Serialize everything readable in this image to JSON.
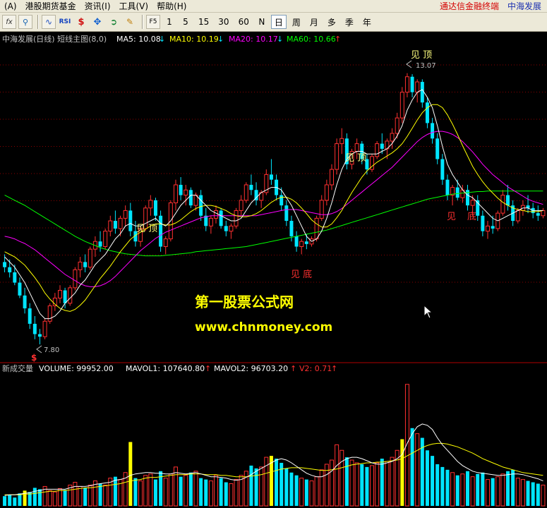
{
  "menubar": {
    "items": [
      "(A)",
      "港股期货基金",
      "资讯(I)",
      "工具(V)",
      "帮助(H)"
    ],
    "title_terminal": "通达信金融终端",
    "title_stock": "中海发展"
  },
  "toolbar": {
    "icons": [
      "fx-icon",
      "search-icon",
      "wave-icon",
      "rsi-icon",
      "dollar-icon",
      "move-icon",
      "exit-icon",
      "pen-icon"
    ],
    "f5_label": "F5",
    "periods": [
      "1",
      "5",
      "15",
      "30",
      "60",
      "N",
      "日",
      "周",
      "月",
      "多",
      "季",
      "年"
    ],
    "active_period": "日"
  },
  "price_panel": {
    "header_label": "中海发展(日线) 短线主图(8,0)",
    "ma5": "MA5: 10.08",
    "ma10": "MA10: 10.19",
    "ma20": "MA20: 10.17",
    "ma60": "MA60: 10.66",
    "colors": {
      "ma5": "#ffffff",
      "ma10": "#ffff00",
      "ma20": "#ff00ff",
      "ma60": "#00ff00",
      "up": "#ff3030",
      "down": "#00e5ff",
      "grid": "#8b0000"
    },
    "annotations": [
      {
        "text": "见 顶",
        "color": "#ffff7f"
      },
      {
        "text": "见 顶",
        "color": "#ffff7f"
      },
      {
        "text": "见 顶",
        "color": "#ffff7f"
      },
      {
        "text": "见 底",
        "color": "#ff3030"
      },
      {
        "text": "见",
        "color": "#ff3030"
      },
      {
        "text": "底",
        "color": "#ff3030"
      }
    ],
    "high_marker": "13.07",
    "low_marker": "7.80",
    "signal_glyph": "$"
  },
  "watermark": {
    "line1": "第一股票公式网",
    "line2": "www.chnmoney.com",
    "color": "#ffff00"
  },
  "volume_panel": {
    "header_label": "新成交量",
    "volume": "VOLUME: 99952.00",
    "mavol1": "MAVOL1: 107640.80",
    "mavol2": "MAVOL2: 96703.20",
    "v2": "V2: 0.71",
    "colors": {
      "label": "#ffffff",
      "v2": "#ff3030",
      "highlight": "#ffff00"
    }
  },
  "chart_data": {
    "type": "candlestick",
    "ohlc": [
      [
        9.4,
        9.55,
        9.2,
        9.3
      ],
      [
        9.3,
        9.45,
        9.1,
        9.2
      ],
      [
        9.2,
        9.35,
        8.95,
        9.0
      ],
      [
        9.0,
        9.1,
        8.7,
        8.75
      ],
      [
        8.75,
        8.9,
        8.4,
        8.5
      ],
      [
        8.5,
        8.6,
        8.1,
        8.2
      ],
      [
        8.2,
        8.35,
        7.9,
        8.0
      ],
      [
        8.0,
        8.1,
        7.8,
        7.95
      ],
      [
        7.95,
        8.3,
        7.9,
        8.25
      ],
      [
        8.25,
        8.6,
        8.2,
        8.55
      ],
      [
        8.55,
        8.8,
        8.45,
        8.7
      ],
      [
        8.7,
        8.95,
        8.6,
        8.85
      ],
      [
        8.85,
        8.9,
        8.5,
        8.6
      ],
      [
        8.6,
        8.95,
        8.55,
        8.9
      ],
      [
        8.9,
        9.3,
        8.85,
        9.25
      ],
      [
        9.25,
        9.5,
        9.1,
        9.4
      ],
      [
        9.4,
        9.55,
        9.2,
        9.3
      ],
      [
        9.3,
        9.7,
        9.25,
        9.65
      ],
      [
        9.65,
        9.9,
        9.5,
        9.8
      ],
      [
        9.8,
        10.0,
        9.6,
        9.7
      ],
      [
        9.7,
        10.05,
        9.65,
        10.0
      ],
      [
        10.0,
        10.3,
        9.9,
        10.2
      ],
      [
        10.2,
        10.4,
        9.95,
        10.05
      ],
      [
        10.05,
        10.3,
        9.9,
        10.25
      ],
      [
        10.25,
        10.5,
        10.1,
        10.4
      ],
      [
        10.4,
        10.55,
        9.9,
        10.0
      ],
      [
        10.0,
        10.2,
        9.7,
        9.8
      ],
      [
        9.8,
        10.1,
        9.7,
        10.05
      ],
      [
        10.05,
        10.5,
        10.0,
        10.45
      ],
      [
        10.45,
        10.7,
        10.3,
        10.6
      ],
      [
        10.6,
        10.65,
        10.2,
        10.3
      ],
      [
        10.3,
        10.4,
        9.6,
        9.7
      ],
      [
        9.7,
        9.9,
        9.55,
        9.85
      ],
      [
        9.85,
        10.6,
        9.8,
        10.55
      ],
      [
        10.55,
        11.0,
        10.4,
        10.9
      ],
      [
        10.9,
        11.05,
        10.6,
        10.7
      ],
      [
        10.7,
        10.9,
        10.5,
        10.8
      ],
      [
        10.8,
        10.85,
        10.45,
        10.5
      ],
      [
        10.5,
        10.75,
        10.4,
        10.7
      ],
      [
        10.7,
        10.8,
        10.2,
        10.3
      ],
      [
        10.3,
        10.45,
        10.0,
        10.1
      ],
      [
        10.1,
        10.3,
        9.95,
        10.25
      ],
      [
        10.25,
        10.5,
        10.15,
        10.4
      ],
      [
        10.4,
        10.45,
        10.05,
        10.1
      ],
      [
        10.1,
        10.2,
        9.9,
        10.0
      ],
      [
        10.0,
        10.15,
        9.85,
        10.1
      ],
      [
        10.1,
        10.45,
        10.05,
        10.4
      ],
      [
        10.4,
        10.7,
        10.3,
        10.6
      ],
      [
        10.6,
        10.95,
        10.55,
        10.9
      ],
      [
        10.9,
        11.1,
        10.7,
        10.8
      ],
      [
        10.8,
        10.95,
        10.5,
        10.6
      ],
      [
        10.6,
        10.8,
        10.45,
        10.75
      ],
      [
        10.75,
        11.2,
        10.7,
        11.1
      ],
      [
        11.1,
        11.4,
        10.9,
        11.0
      ],
      [
        11.0,
        11.1,
        10.6,
        10.7
      ],
      [
        10.7,
        10.85,
        10.4,
        10.5
      ],
      [
        10.5,
        10.6,
        10.1,
        10.2
      ],
      [
        10.2,
        10.3,
        9.8,
        9.9
      ],
      [
        9.9,
        10.0,
        9.6,
        9.7
      ],
      [
        9.7,
        9.85,
        9.55,
        9.8
      ],
      [
        9.8,
        9.95,
        9.65,
        9.75
      ],
      [
        9.75,
        9.9,
        9.7,
        9.85
      ],
      [
        9.85,
        10.3,
        9.8,
        10.25
      ],
      [
        10.25,
        10.7,
        10.2,
        10.6
      ],
      [
        10.6,
        11.0,
        10.5,
        10.9
      ],
      [
        10.9,
        11.3,
        10.8,
        11.2
      ],
      [
        11.2,
        11.8,
        11.1,
        11.7
      ],
      [
        11.7,
        12.0,
        11.5,
        11.8
      ],
      [
        11.8,
        11.9,
        11.2,
        11.3
      ],
      [
        11.3,
        11.6,
        11.2,
        11.55
      ],
      [
        11.55,
        11.8,
        11.4,
        11.7
      ],
      [
        11.7,
        11.75,
        11.3,
        11.4
      ],
      [
        11.4,
        11.5,
        11.1,
        11.2
      ],
      [
        11.2,
        11.5,
        11.15,
        11.45
      ],
      [
        11.45,
        11.75,
        11.4,
        11.7
      ],
      [
        11.7,
        11.9,
        11.5,
        11.6
      ],
      [
        11.6,
        11.8,
        11.4,
        11.75
      ],
      [
        11.75,
        12.0,
        11.6,
        11.9
      ],
      [
        11.9,
        12.3,
        11.8,
        12.2
      ],
      [
        12.2,
        12.8,
        12.1,
        12.7
      ],
      [
        12.7,
        13.07,
        12.6,
        13.0
      ],
      [
        13.0,
        13.05,
        12.6,
        12.7
      ],
      [
        12.7,
        12.95,
        12.5,
        12.9
      ],
      [
        12.9,
        12.95,
        12.4,
        12.5
      ],
      [
        12.5,
        12.6,
        12.0,
        12.1
      ],
      [
        12.1,
        12.2,
        11.7,
        11.8
      ],
      [
        11.8,
        11.9,
        11.3,
        11.4
      ],
      [
        11.4,
        11.5,
        10.9,
        11.0
      ],
      [
        11.0,
        11.1,
        10.6,
        10.7
      ],
      [
        10.7,
        10.9,
        10.5,
        10.85
      ],
      [
        10.85,
        11.0,
        10.6,
        10.65
      ],
      [
        10.65,
        10.9,
        10.55,
        10.8
      ],
      [
        10.8,
        10.9,
        10.4,
        10.5
      ],
      [
        10.5,
        10.7,
        10.3,
        10.6
      ],
      [
        10.6,
        10.7,
        10.2,
        10.3
      ],
      [
        10.3,
        10.4,
        9.9,
        10.0
      ],
      [
        10.0,
        10.2,
        9.85,
        10.1
      ],
      [
        10.1,
        10.3,
        9.95,
        10.05
      ],
      [
        10.05,
        10.4,
        10.0,
        10.35
      ],
      [
        10.35,
        10.8,
        10.3,
        10.7
      ],
      [
        10.7,
        10.9,
        10.4,
        10.5
      ],
      [
        10.5,
        10.6,
        10.1,
        10.2
      ],
      [
        10.2,
        10.45,
        10.15,
        10.4
      ],
      [
        10.4,
        10.6,
        10.3,
        10.5
      ],
      [
        10.5,
        10.7,
        10.35,
        10.45
      ],
      [
        10.45,
        10.55,
        10.25,
        10.35
      ],
      [
        10.35,
        10.5,
        10.2,
        10.3
      ],
      [
        10.3,
        10.45,
        10.25,
        10.4
      ]
    ],
    "ma5": [
      9.5,
      9.4,
      9.3,
      9.15,
      9.0,
      8.8,
      8.6,
      8.4,
      8.3,
      8.3,
      8.35,
      8.45,
      8.6,
      8.7,
      8.8,
      8.95,
      9.05,
      9.2,
      9.35,
      9.45,
      9.55,
      9.7,
      9.85,
      9.95,
      10.1,
      10.15,
      10.1,
      10.1,
      10.15,
      10.2,
      10.25,
      10.15,
      10.1,
      10.2,
      10.35,
      10.5,
      10.6,
      10.7,
      10.7,
      10.6,
      10.5,
      10.4,
      10.35,
      10.3,
      10.25,
      10.2,
      10.2,
      10.25,
      10.4,
      10.55,
      10.65,
      10.75,
      10.8,
      10.85,
      10.85,
      10.8,
      10.65,
      10.5,
      10.3,
      10.1,
      9.9,
      9.8,
      9.85,
      10.0,
      10.25,
      10.55,
      10.9,
      11.2,
      11.4,
      11.5,
      11.55,
      11.55,
      11.5,
      11.5,
      11.5,
      11.55,
      11.6,
      11.7,
      11.85,
      12.05,
      12.35,
      12.55,
      12.7,
      12.75,
      12.6,
      12.4,
      12.05,
      11.65,
      11.3,
      11.1,
      10.95,
      10.8,
      10.7,
      10.65,
      10.55,
      10.45,
      10.35,
      10.25,
      10.2,
      10.25,
      10.3,
      10.35,
      10.4,
      10.45,
      10.45,
      10.4,
      10.4,
      10.4
    ],
    "ma10": [
      9.6,
      9.55,
      9.5,
      9.42,
      9.34,
      9.22,
      9.1,
      8.96,
      8.8,
      8.68,
      8.58,
      8.5,
      8.46,
      8.44,
      8.48,
      8.56,
      8.66,
      8.8,
      8.94,
      9.08,
      9.2,
      9.32,
      9.46,
      9.6,
      9.72,
      9.84,
      9.92,
      9.98,
      10.04,
      10.1,
      10.14,
      10.14,
      10.12,
      10.12,
      10.16,
      10.22,
      10.3,
      10.38,
      10.44,
      10.48,
      10.5,
      10.5,
      10.48,
      10.44,
      10.4,
      10.34,
      10.3,
      10.28,
      10.28,
      10.3,
      10.34,
      10.4,
      10.48,
      10.56,
      10.62,
      10.66,
      10.66,
      10.62,
      10.55,
      10.45,
      10.34,
      10.22,
      10.14,
      10.08,
      10.08,
      10.14,
      10.26,
      10.4,
      10.58,
      10.75,
      10.9,
      11.05,
      11.17,
      11.26,
      11.34,
      11.4,
      11.46,
      11.52,
      11.6,
      11.7,
      11.84,
      12.0,
      12.16,
      12.3,
      12.4,
      12.46,
      12.46,
      12.4,
      12.26,
      12.08,
      11.88,
      11.66,
      11.46,
      11.26,
      11.1,
      10.96,
      10.84,
      10.74,
      10.64,
      10.56,
      10.5,
      10.45,
      10.42,
      10.4,
      10.38,
      10.38,
      10.38,
      10.4
    ],
    "ma20": [
      9.9,
      9.88,
      9.85,
      9.8,
      9.76,
      9.7,
      9.64,
      9.56,
      9.48,
      9.4,
      9.32,
      9.24,
      9.16,
      9.1,
      9.04,
      8.98,
      8.94,
      8.92,
      8.92,
      8.94,
      8.98,
      9.04,
      9.12,
      9.22,
      9.32,
      9.42,
      9.52,
      9.62,
      9.7,
      9.78,
      9.86,
      9.92,
      9.98,
      10.02,
      10.06,
      10.1,
      10.14,
      10.18,
      10.22,
      10.26,
      10.28,
      10.3,
      10.3,
      10.3,
      10.3,
      10.3,
      10.3,
      10.3,
      10.3,
      10.3,
      10.3,
      10.32,
      10.34,
      10.36,
      10.38,
      10.4,
      10.42,
      10.42,
      10.42,
      10.4,
      10.38,
      10.36,
      10.34,
      10.32,
      10.32,
      10.34,
      10.38,
      10.44,
      10.52,
      10.6,
      10.68,
      10.76,
      10.84,
      10.92,
      11.0,
      11.08,
      11.16,
      11.24,
      11.34,
      11.44,
      11.54,
      11.64,
      11.74,
      11.82,
      11.88,
      11.92,
      11.94,
      11.94,
      11.92,
      11.88,
      11.82,
      11.74,
      11.64,
      11.54,
      11.42,
      11.3,
      11.2,
      11.1,
      11.02,
      10.94,
      10.86,
      10.8,
      10.74,
      10.68,
      10.62,
      10.58,
      10.55,
      10.52
    ],
    "ma60": [
      10.7,
      10.65,
      10.6,
      10.55,
      10.5,
      10.44,
      10.38,
      10.32,
      10.26,
      10.2,
      10.14,
      10.08,
      10.02,
      9.96,
      9.9,
      9.85,
      9.8,
      9.76,
      9.72,
      9.68,
      9.65,
      9.62,
      9.6,
      9.58,
      9.56,
      9.55,
      9.54,
      9.53,
      9.52,
      9.52,
      9.52,
      9.52,
      9.53,
      9.54,
      9.55,
      9.56,
      9.57,
      9.58,
      9.6,
      9.61,
      9.62,
      9.63,
      9.64,
      9.65,
      9.66,
      9.67,
      9.68,
      9.69,
      9.7,
      9.72,
      9.74,
      9.76,
      9.78,
      9.8,
      9.82,
      9.84,
      9.86,
      9.88,
      9.9,
      9.92,
      9.94,
      9.96,
      9.98,
      10.0,
      10.02,
      10.05,
      10.08,
      10.11,
      10.14,
      10.17,
      10.2,
      10.23,
      10.26,
      10.29,
      10.32,
      10.35,
      10.38,
      10.41,
      10.44,
      10.47,
      10.5,
      10.53,
      10.56,
      10.59,
      10.62,
      10.64,
      10.66,
      10.68,
      10.7,
      10.72,
      10.73,
      10.74,
      10.75,
      10.76,
      10.77,
      10.77,
      10.78,
      10.78,
      10.78,
      10.78,
      10.78,
      10.78,
      10.78,
      10.78,
      10.78,
      10.78,
      10.78,
      10.78
    ],
    "ylim": [
      7.5,
      13.6
    ],
    "volume": [
      14,
      16,
      12,
      18,
      22,
      20,
      26,
      24,
      28,
      22,
      20,
      25,
      23,
      30,
      34,
      28,
      26,
      30,
      36,
      32,
      30,
      40,
      42,
      38,
      48,
      92,
      40,
      36,
      44,
      46,
      38,
      50,
      40,
      46,
      56,
      42,
      44,
      48,
      50,
      40,
      38,
      36,
      44,
      40,
      34,
      32,
      38,
      44,
      50,
      58,
      54,
      56,
      70,
      72,
      68,
      62,
      54,
      48,
      44,
      40,
      38,
      36,
      42,
      52,
      60,
      66,
      88,
      80,
      70,
      66,
      62,
      60,
      56,
      58,
      62,
      68,
      64,
      70,
      80,
      96,
      175,
      112,
      104,
      98,
      80,
      72,
      60,
      56,
      52,
      48,
      44,
      46,
      50,
      42,
      46,
      48,
      38,
      40,
      42,
      46,
      50,
      52,
      40,
      38,
      36,
      34,
      32,
      30
    ],
    "volume_highlight": [
      4,
      25,
      53,
      79
    ],
    "mavol1": [
      15,
      16,
      16,
      17,
      18,
      19,
      21,
      22,
      24,
      24,
      24,
      24,
      24,
      26,
      28,
      28,
      28,
      29,
      31,
      32,
      33,
      34,
      37,
      38,
      40,
      44,
      46,
      47,
      48,
      48,
      47,
      47,
      46,
      46,
      48,
      47,
      46,
      47,
      48,
      46,
      44,
      42,
      42,
      41,
      40,
      38,
      37,
      38,
      41,
      45,
      50,
      54,
      58,
      62,
      66,
      68,
      66,
      62,
      57,
      52,
      47,
      44,
      42,
      42,
      45,
      50,
      58,
      64,
      68,
      70,
      70,
      68,
      65,
      62,
      60,
      60,
      62,
      64,
      68,
      74,
      90,
      104,
      114,
      118,
      116,
      110,
      98,
      88,
      80,
      72,
      64,
      58,
      54,
      50,
      48,
      47,
      46,
      45,
      44,
      44,
      45,
      46,
      46,
      45,
      43,
      41,
      39,
      36
    ],
    "mavol2": [
      16,
      16,
      16,
      16,
      17,
      17,
      18,
      19,
      20,
      21,
      21,
      22,
      22,
      23,
      24,
      25,
      26,
      26,
      27,
      28,
      29,
      30,
      31,
      32,
      34,
      36,
      37,
      38,
      40,
      41,
      41,
      42,
      43,
      44,
      45,
      45,
      45,
      46,
      46,
      46,
      45,
      45,
      45,
      44,
      44,
      43,
      42,
      42,
      42,
      43,
      44,
      45,
      47,
      49,
      51,
      53,
      54,
      55,
      55,
      55,
      54,
      53,
      52,
      51,
      51,
      52,
      53,
      55,
      57,
      59,
      60,
      61,
      62,
      62,
      63,
      63,
      64,
      65,
      66,
      68,
      72,
      76,
      80,
      84,
      87,
      89,
      90,
      90,
      89,
      87,
      85,
      82,
      79,
      76,
      72,
      68,
      65,
      62,
      59,
      56,
      54,
      52,
      50,
      48,
      47,
      46,
      45,
      44
    ],
    "volume_ylim": [
      0,
      190
    ]
  }
}
